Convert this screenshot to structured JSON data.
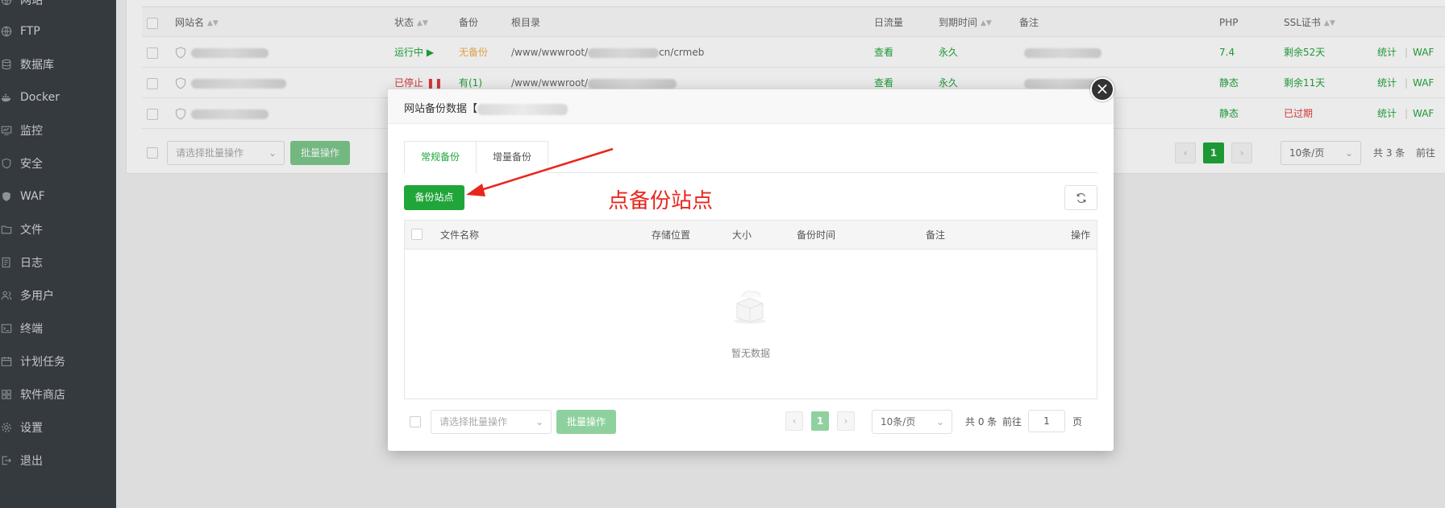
{
  "sidebar": {
    "items": [
      {
        "label": "网站",
        "icon": "globe-icon"
      },
      {
        "label": "FTP",
        "icon": "globe-icon"
      },
      {
        "label": "数据库",
        "icon": "database-icon"
      },
      {
        "label": "Docker",
        "icon": "docker-icon"
      },
      {
        "label": "监控",
        "icon": "monitor-icon"
      },
      {
        "label": "安全",
        "icon": "shield-icon"
      },
      {
        "label": "WAF",
        "icon": "waf-shield-icon"
      },
      {
        "label": "文件",
        "icon": "folder-icon"
      },
      {
        "label": "日志",
        "icon": "log-icon"
      },
      {
        "label": "多用户",
        "icon": "users-icon"
      },
      {
        "label": "终端",
        "icon": "terminal-icon"
      },
      {
        "label": "计划任务",
        "icon": "calendar-icon"
      },
      {
        "label": "软件商店",
        "icon": "grid-icon"
      },
      {
        "label": "设置",
        "icon": "gear-icon"
      },
      {
        "label": "退出",
        "icon": "logout-icon"
      }
    ]
  },
  "site_table": {
    "headers": {
      "name": "网站名",
      "status": "状态",
      "backup": "备份",
      "root": "根目录",
      "traffic": "日流量",
      "expire": "到期时间",
      "note": "备注",
      "php": "PHP",
      "ssl": "SSL证书"
    },
    "rows": [
      {
        "status": "运行中",
        "status_icon": "play-icon",
        "backup": "无备份",
        "root_prefix": "/www/wwwroot/",
        "root_suffix": "cn/crmeb",
        "traffic": "查看",
        "expire": "永久",
        "php": "7.4",
        "ssl": "剩余52天",
        "action1": "统计",
        "action2": "WAF"
      },
      {
        "status": "已停止",
        "status_icon": "pause-icon",
        "backup": "有(1)",
        "root_prefix": "/www/wwwroot/",
        "root_suffix": "",
        "traffic": "查看",
        "expire": "永久",
        "php": "静态",
        "ssl": "剩余11天",
        "action1": "统计",
        "action2": "WAF"
      },
      {
        "status": "",
        "status_icon": "",
        "backup": "",
        "root_prefix": "",
        "root_suffix": "",
        "traffic": "",
        "expire": "",
        "php": "静态",
        "ssl": "已过期",
        "action1": "统计",
        "action2": "WAF"
      }
    ],
    "batch_placeholder": "请选择批量操作",
    "batch_button": "批量操作",
    "pager": {
      "current": "1",
      "per_page": "10条/页",
      "total": "共 3 条",
      "goto": "前往"
    }
  },
  "modal": {
    "title": "网站备份数据【",
    "tabs": [
      {
        "label": "常规备份",
        "active": true
      },
      {
        "label": "增量备份",
        "active": false
      }
    ],
    "backup_button": "备份站点",
    "table_headers": {
      "file_name": "文件名称",
      "location": "存储位置",
      "size": "大小",
      "backup_time": "备份时间",
      "note": "备注",
      "actions": "操作"
    },
    "empty_text": "暂无数据",
    "batch_placeholder": "请选择批量操作",
    "batch_button": "批量操作",
    "pager": {
      "current": "1",
      "per_page": "10条/页",
      "total": "共 0 条",
      "goto": "前往",
      "goto_value": "1",
      "page_suffix": "页"
    }
  },
  "annotation": {
    "text": "点备份站点"
  },
  "colors": {
    "accent": "#20a53a",
    "annotation": "#e8261d",
    "sidebar": "#3a3f45"
  }
}
